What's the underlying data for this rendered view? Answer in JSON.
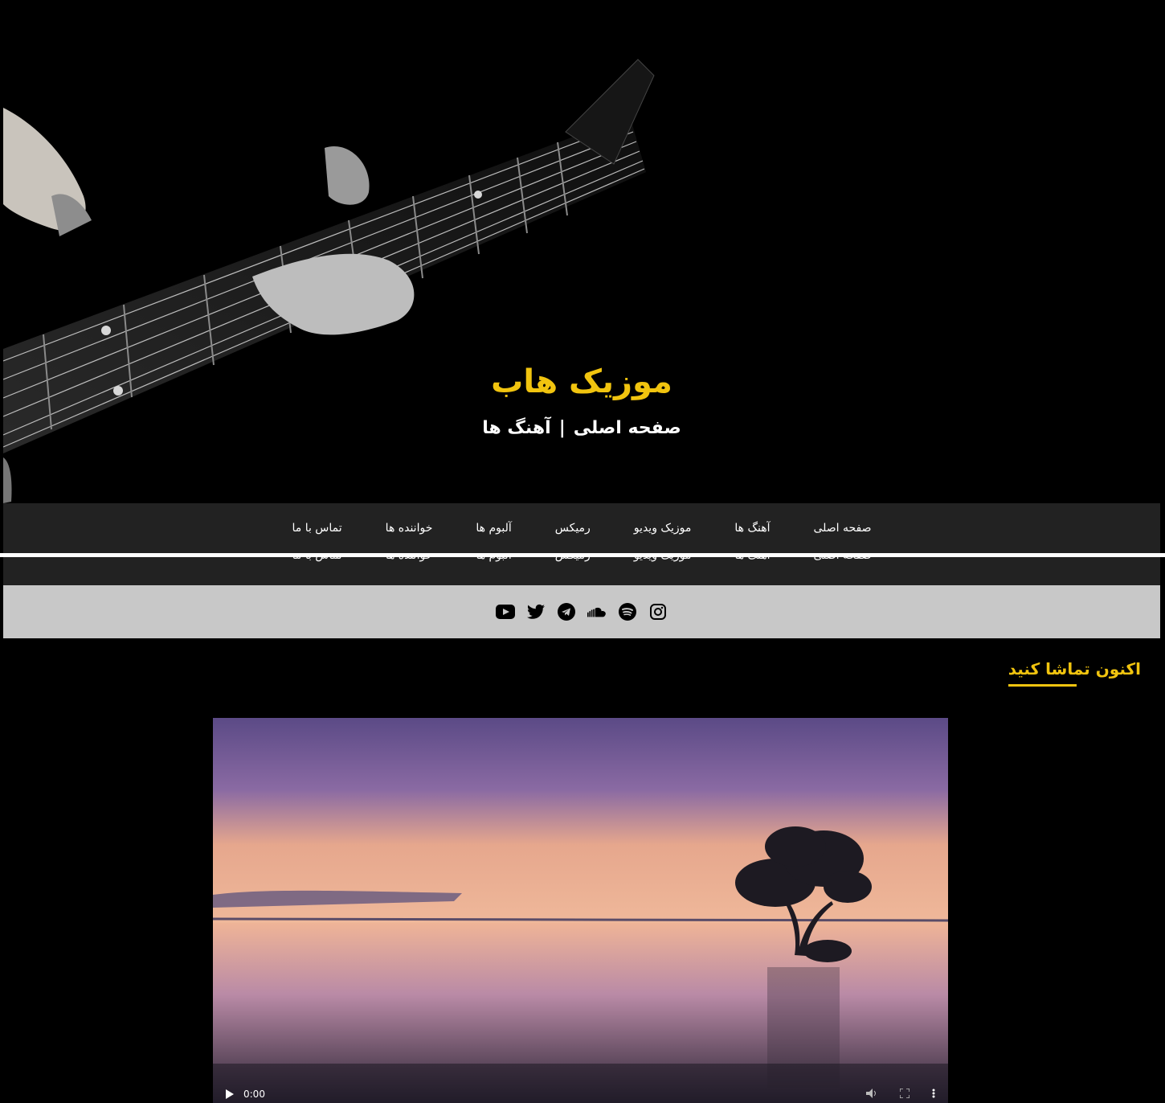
{
  "hero": {
    "title": "موزیک هاب",
    "breadcrumb_home": "صفحه اصلی",
    "breadcrumb_separator": "|",
    "breadcrumb_current": "آهنگ ها"
  },
  "nav": {
    "items": [
      "صفحه اصلی",
      "آهنگ ها",
      "موزیک ویدیو",
      "رمیکس",
      "آلبوم ها",
      "خواننده ها",
      "تماس با ما"
    ]
  },
  "social": {
    "icons": [
      "instagram-icon",
      "spotify-icon",
      "soundcloud-icon",
      "telegram-icon",
      "twitter-icon",
      "youtube-icon"
    ]
  },
  "watch": {
    "title": "اکنون تماشا کنید"
  },
  "video": {
    "time": "0:00",
    "progress": 0
  },
  "colors": {
    "accent": "#f1c40f",
    "nav_bg": "#222222",
    "social_bg": "#c8c8c8"
  }
}
